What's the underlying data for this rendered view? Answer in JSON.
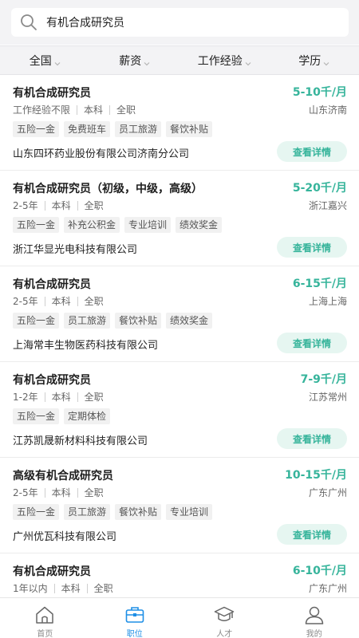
{
  "search": {
    "value": "有机合成研究员",
    "placeholder": ""
  },
  "filters": [
    {
      "label": "全国"
    },
    {
      "label": "薪资"
    },
    {
      "label": "工作经验"
    },
    {
      "label": "学历"
    }
  ],
  "jobs": [
    {
      "title": "有机合成研究员",
      "salary": "5-10千/月",
      "experience": "工作经验不限",
      "education": "本科",
      "type": "全职",
      "location": "山东济南",
      "tags": [
        "五险一金",
        "免费班车",
        "员工旅游",
        "餐饮补贴"
      ],
      "company": "山东四环药业股份有限公司济南分公司",
      "action": "查看详情"
    },
    {
      "title": "有机合成研究员（初级，中级，高级）",
      "salary": "5-20千/月",
      "experience": "2-5年",
      "education": "本科",
      "type": "全职",
      "location": "浙江嘉兴",
      "tags": [
        "五险一金",
        "补充公积金",
        "专业培训",
        "绩效奖金"
      ],
      "company": "浙江华显光电科技有限公司",
      "action": "查看详情"
    },
    {
      "title": "有机合成研究员",
      "salary": "6-15千/月",
      "experience": "2-5年",
      "education": "本科",
      "type": "全职",
      "location": "上海上海",
      "tags": [
        "五险一金",
        "员工旅游",
        "餐饮补贴",
        "绩效奖金"
      ],
      "company": "上海常丰生物医药科技有限公司",
      "action": "查看详情"
    },
    {
      "title": "有机合成研究员",
      "salary": "7-9千/月",
      "experience": "1-2年",
      "education": "本科",
      "type": "全职",
      "location": "江苏常州",
      "tags": [
        "五险一金",
        "定期体检"
      ],
      "company": "江苏凯晟新材料科技有限公司",
      "action": "查看详情"
    },
    {
      "title": "高级有机合成研究员",
      "salary": "10-15千/月",
      "experience": "2-5年",
      "education": "本科",
      "type": "全职",
      "location": "广东广州",
      "tags": [
        "五险一金",
        "员工旅游",
        "餐饮补贴",
        "专业培训"
      ],
      "company": "广州优瓦科技有限公司",
      "action": "查看详情"
    },
    {
      "title": "有机合成研究员",
      "salary": "6-10千/月",
      "experience": "1年以内",
      "education": "本科",
      "type": "全职",
      "location": "广东广州",
      "tags": [],
      "company": "",
      "action": ""
    }
  ],
  "tabbar": [
    {
      "label": "首页",
      "icon": "home-icon"
    },
    {
      "label": "职位",
      "icon": "briefcase-icon",
      "active": true
    },
    {
      "label": "人才",
      "icon": "graduation-cap-icon"
    },
    {
      "label": "我的",
      "icon": "user-icon"
    }
  ],
  "colors": {
    "accent": "#36b49b",
    "tab_active": "#1e8fe6",
    "background": "#f3f3f5"
  }
}
